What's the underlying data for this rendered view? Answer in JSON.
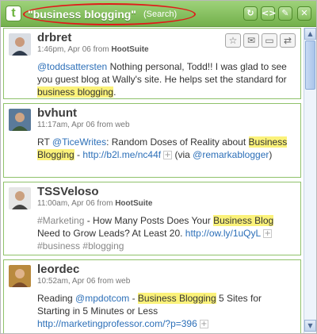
{
  "titlebar": {
    "logo_glyph": "t",
    "query": "\"business blogging\"",
    "search_label": "(Search)",
    "buttons": [
      "refresh-icon",
      "code-icon",
      "edit-icon",
      "close-icon"
    ],
    "colors": {
      "bar": "#7dbb53",
      "highlight_oval": "#e01a1a"
    }
  },
  "tweets": [
    {
      "user": "drbret",
      "time": "1:46pm, Apr 06 from ",
      "source": "HootSuite",
      "actions": [
        "favorite-icon",
        "send-icon",
        "reply-icon",
        "retweet-icon"
      ],
      "body": {
        "mention": "@toddsattersten",
        "text1": " Nothing personal, Todd!! I was glad to see you guest blog at Wally's site. He helps set the standard for ",
        "highlight": "business blogging",
        "text2": "."
      }
    },
    {
      "user": "bvhunt",
      "time": "11:17am, Apr 06 from web",
      "body": {
        "prefix": "RT ",
        "mention": "@TiceWrites",
        "text1": ": Random Doses of Reality about ",
        "highlight": "Business Blogging",
        "text2": " - ",
        "link": "http://b2l.me/nc44f",
        "text3": " (via ",
        "mention2": "@remarkablogger",
        "text4": ")"
      }
    },
    {
      "user": "TSSVeloso",
      "time": "11:00am, Apr 06 from ",
      "source": "HootSuite",
      "body": {
        "tag1": "#Marketing",
        "text1": " - How Many Posts Does Your ",
        "highlight": "Business Blog",
        "text2": " Need to Grow Leads? At Least 20. ",
        "link": "http://ow.ly/1uQyL",
        "tag2": "#business",
        "tag3": "#blogging"
      }
    },
    {
      "user": "leordec",
      "time": "10:52am, Apr 06 from web",
      "body": {
        "text0": "Reading ",
        "mention": "@mpdotcom",
        "text1": " - ",
        "highlight": "Business Blogging",
        "text2": " 5 Sites for Starting in 5 Minutes or Less",
        "link": "http://marketingprofessor.com/?p=396"
      }
    }
  ],
  "scrollbar": {
    "up_glyph": "▲",
    "down_glyph": "▼"
  }
}
